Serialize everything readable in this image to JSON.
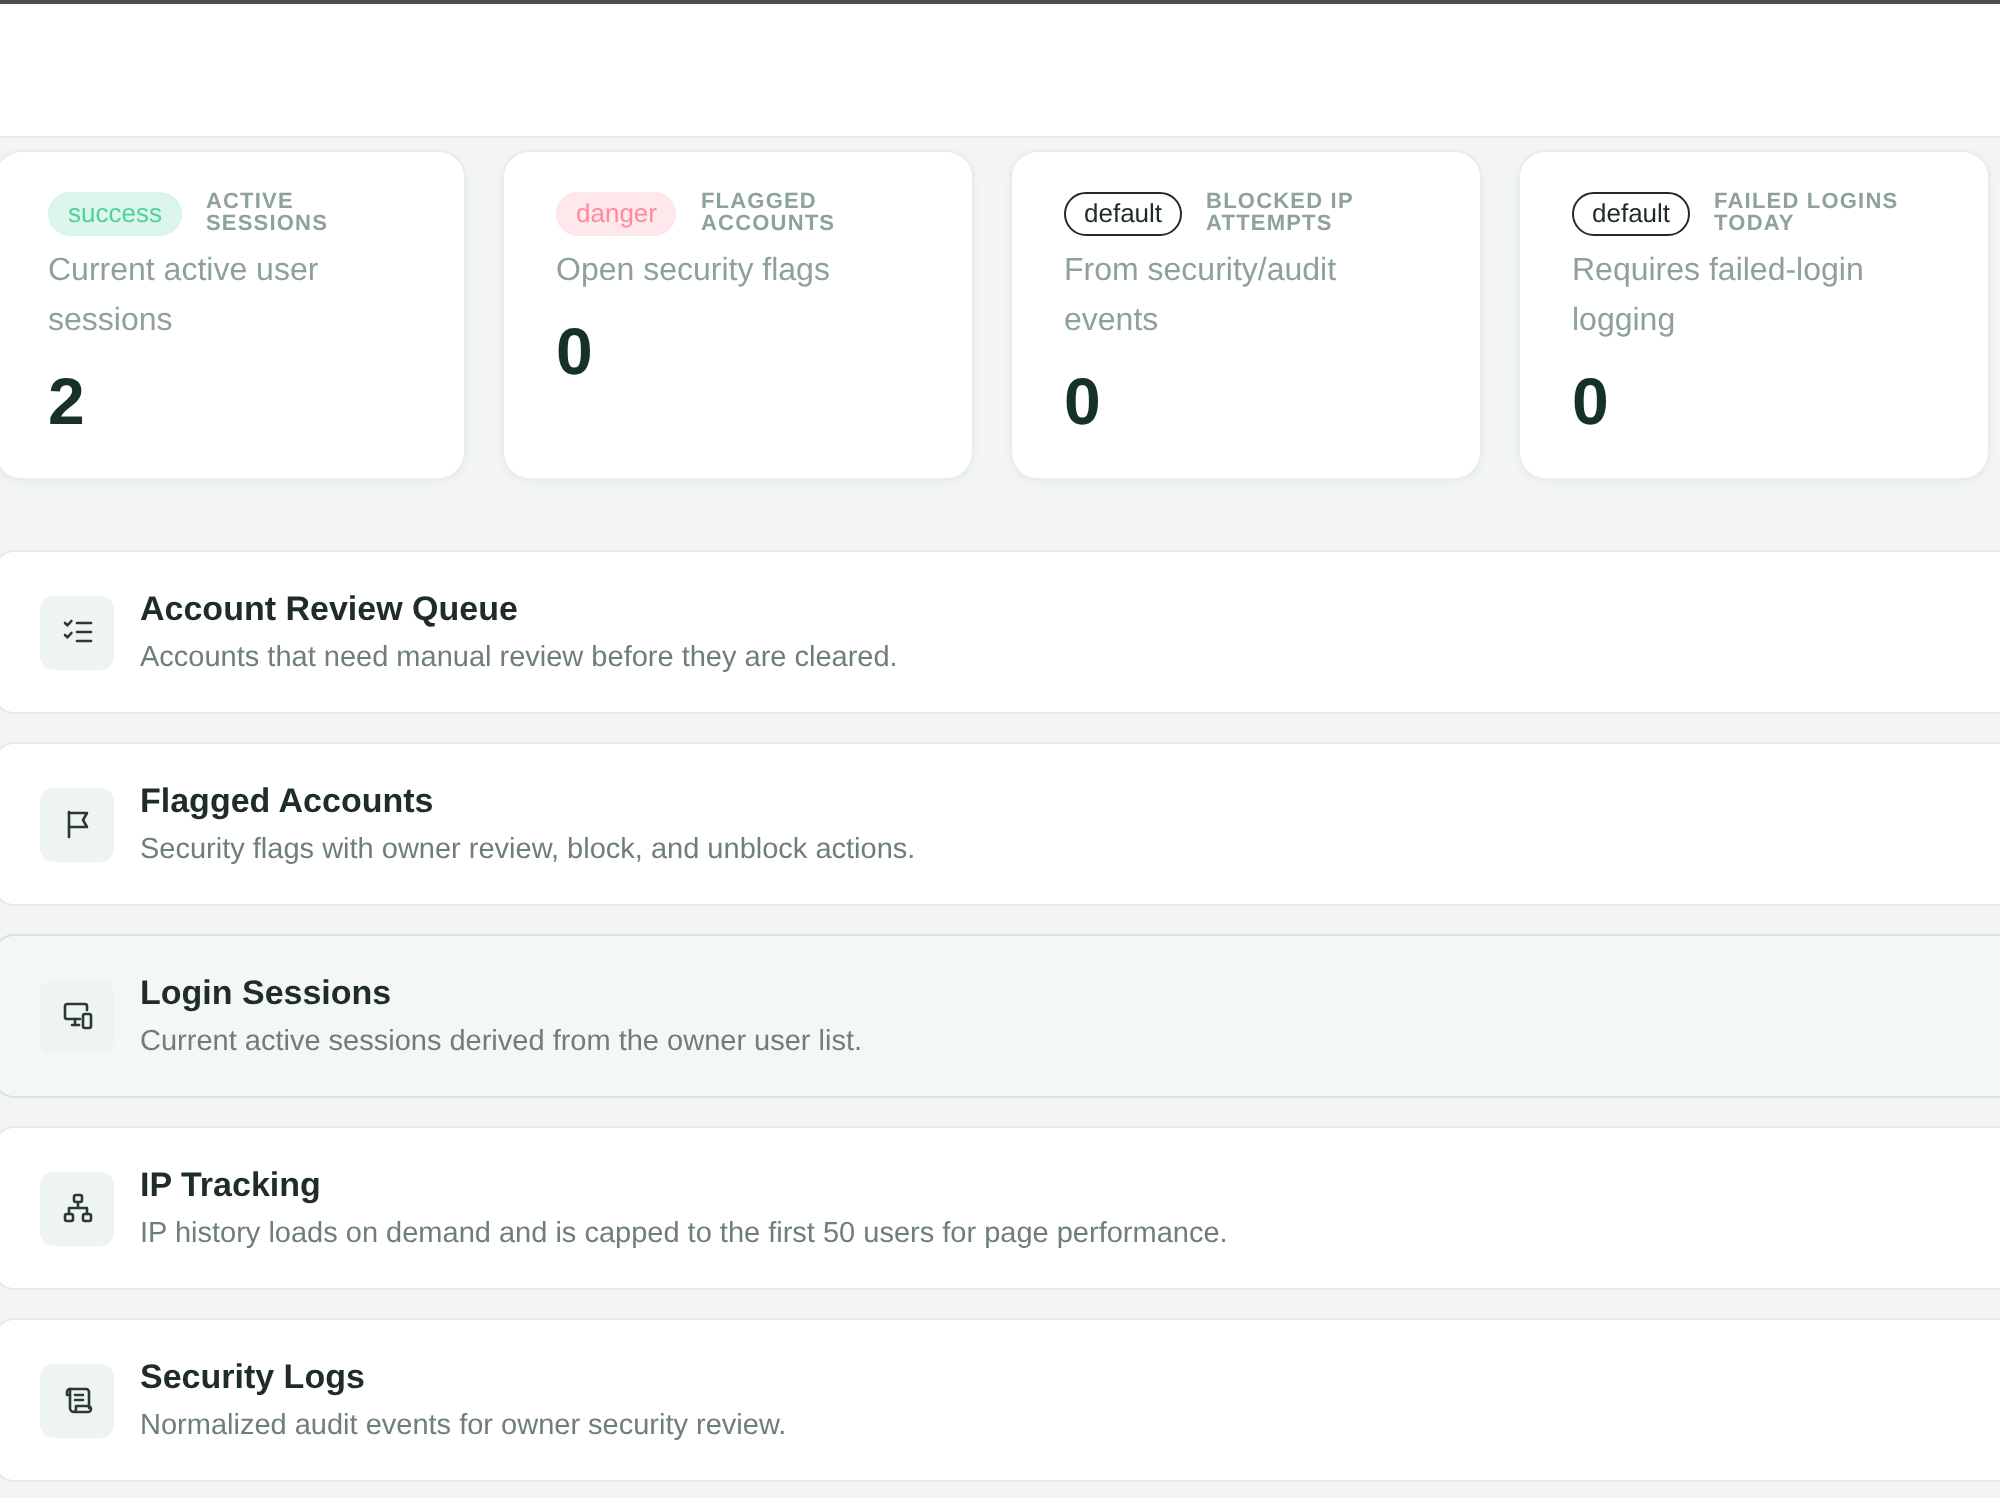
{
  "stats": [
    {
      "badge": {
        "text": "success",
        "color": "#4fd29a",
        "outlined": false
      },
      "label": "ACTIVE SESSIONS",
      "description": "Current active user sessions",
      "value": "2"
    },
    {
      "badge": {
        "text": "danger",
        "color": "#ff8a9b",
        "outlined": false
      },
      "label": "FLAGGED ACCOUNTS",
      "description": "Open security flags",
      "value": "0"
    },
    {
      "badge": {
        "text": "default",
        "color": "#1f2b28",
        "outlined": true
      },
      "label": "BLOCKED IP ATTEMPTS",
      "description": "From security/audit events",
      "value": "0"
    },
    {
      "badge": {
        "text": "default",
        "color": "#1f2b28",
        "outlined": true
      },
      "label": "FAILED LOGINS TODAY",
      "description": "Requires failed-login logging",
      "value": "0"
    }
  ],
  "sections": [
    {
      "title": "Account Review Queue",
      "description": "Accounts that need manual review before they are cleared.",
      "hovered": false
    },
    {
      "title": "Flagged Accounts",
      "description": "Security flags with owner review, block, and unblock actions.",
      "hovered": false
    },
    {
      "title": "Login Sessions",
      "description": "Current active sessions derived from the owner user list.",
      "hovered": true
    },
    {
      "title": "IP Tracking",
      "description": "IP history loads on demand and is capped to the first 50 users for page performance.",
      "hovered": false
    },
    {
      "title": "Security Logs",
      "description": "Normalized audit events for owner security review.",
      "hovered": false
    }
  ]
}
